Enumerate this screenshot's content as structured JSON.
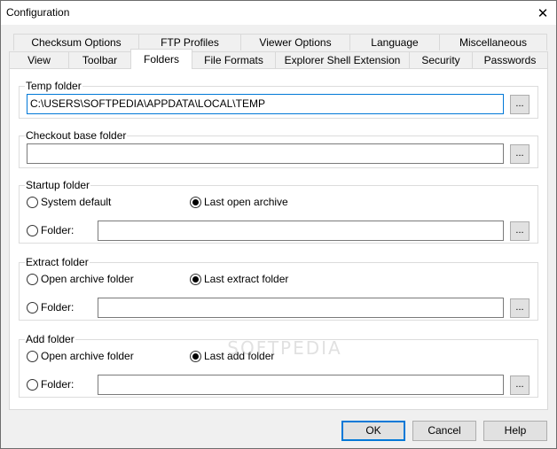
{
  "window": {
    "title": "Configuration",
    "close_icon": "close-icon"
  },
  "tabs_row_back": [
    {
      "label": "Checksum Options"
    },
    {
      "label": "FTP Profiles"
    },
    {
      "label": "Viewer Options"
    },
    {
      "label": "Language"
    },
    {
      "label": "Miscellaneous"
    }
  ],
  "tabs_row_front": [
    {
      "label": "View"
    },
    {
      "label": "Toolbar"
    },
    {
      "label": "Folders"
    },
    {
      "label": "File Formats"
    },
    {
      "label": "Explorer Shell Extension"
    },
    {
      "label": "Security"
    },
    {
      "label": "Passwords"
    }
  ],
  "active_tab": "Folders",
  "temp_folder": {
    "legend": "Temp folder",
    "value": "C:\\USERS\\SOFTPEDIA\\APPDATA\\LOCAL\\TEMP",
    "browse_label": "..."
  },
  "checkout_folder": {
    "legend": "Checkout base folder",
    "value": "",
    "browse_label": "..."
  },
  "startup_folder": {
    "legend": "Startup folder",
    "option1": "System default",
    "option2": "Last open archive",
    "folder_label": "Folder:",
    "selected": "Last open archive",
    "value": "",
    "browse_label": "..."
  },
  "extract_folder": {
    "legend": "Extract folder",
    "option1": "Open archive folder",
    "option2": "Last extract folder",
    "folder_label": "Folder:",
    "selected": "Last extract folder",
    "value": "",
    "browse_label": "..."
  },
  "add_folder": {
    "legend": "Add folder",
    "option1": "Open archive folder",
    "option2": "Last add folder",
    "folder_label": "Folder:",
    "selected": "Last add folder",
    "value": "",
    "browse_label": "..."
  },
  "buttons": {
    "ok": "OK",
    "cancel": "Cancel",
    "help": "Help"
  },
  "watermark": "SOFTPEDIA"
}
